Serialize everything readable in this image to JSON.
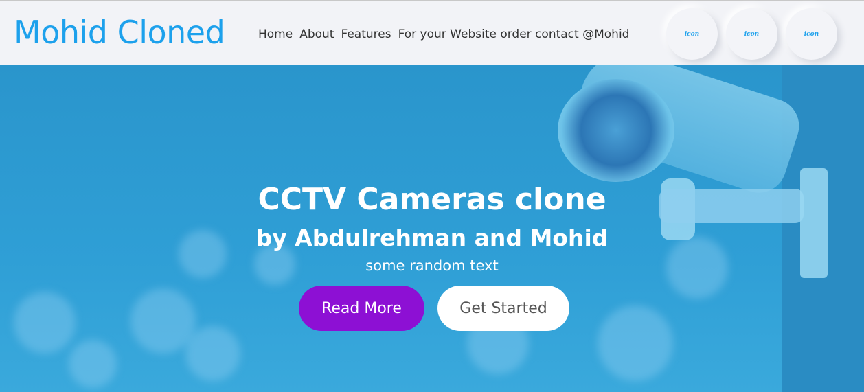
{
  "header": {
    "logo": "Mohid Cloned",
    "nav": [
      {
        "label": "Home"
      },
      {
        "label": "About"
      },
      {
        "label": "Features"
      },
      {
        "label": "For your Website order contact @Mohid"
      }
    ],
    "icon_buttons": [
      {
        "label": "icon"
      },
      {
        "label": "icon"
      },
      {
        "label": "icon"
      }
    ]
  },
  "hero": {
    "title": "CCTV Cameras clone",
    "subtitle": "by Abdulrehman and Mohid",
    "text": "some random text",
    "read_more_label": "Read More",
    "get_started_label": "Get Started"
  },
  "colors": {
    "brand": "#1da1ec",
    "hero_bg": "#2f9fd6",
    "read_more_bg": "#8d10d4"
  }
}
